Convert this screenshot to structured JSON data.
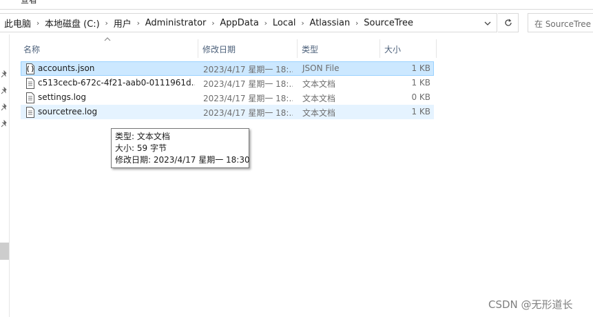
{
  "ribbon": {
    "left_label": "—",
    "view_label": "查看"
  },
  "address_bar": {
    "crumbs": [
      "此电脑",
      "本地磁盘 (C:)",
      "用户",
      "Administrator",
      "AppData",
      "Local",
      "Atlassian",
      "SourceTree"
    ],
    "separator": "›"
  },
  "search": {
    "placeholder": "在 SourceTree"
  },
  "columns": {
    "name": "名称",
    "modified": "修改日期",
    "type": "类型",
    "size": "大小"
  },
  "files": [
    {
      "name": "accounts.json",
      "modified": "2023/4/17 星期一 18:...",
      "type": "JSON File",
      "size": "1 KB",
      "icon": "json-file-icon",
      "state": "selected"
    },
    {
      "name": "c513cecb-672c-4f21-aab0-0111961d...",
      "modified": "2023/4/17 星期一 18:...",
      "type": "文本文档",
      "size": "1 KB",
      "icon": "text-file-icon",
      "state": "normal"
    },
    {
      "name": "settings.log",
      "modified": "2023/4/17 星期一 18:...",
      "type": "文本文档",
      "size": "0 KB",
      "icon": "text-file-icon",
      "state": "normal"
    },
    {
      "name": "sourcetree.log",
      "modified": "2023/4/17 星期一 18:...",
      "type": "文本文档",
      "size": "1 KB",
      "icon": "text-file-icon",
      "state": "hover"
    }
  ],
  "tooltip": {
    "type_line": "类型: 文本文档",
    "size_line": "大小: 59 字节",
    "modified_line": "修改日期: 2023/4/17 星期一 18:30"
  },
  "watermark": "CSDN @无形道长",
  "colors": {
    "selected_bg": "#cce8ff",
    "selected_border": "#99d1ff",
    "hover_bg": "#e5f3ff",
    "header_text": "#4c607a"
  }
}
